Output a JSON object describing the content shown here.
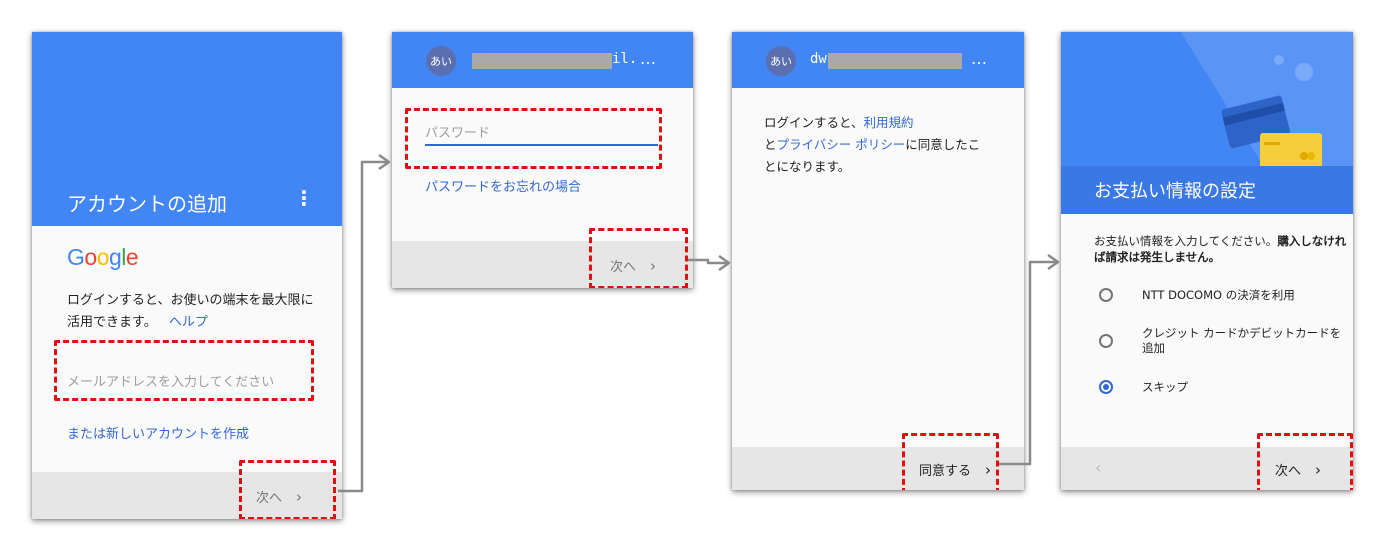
{
  "screen1": {
    "title": "アカウントの追加",
    "menu_icon": "⋮",
    "logo": "Google",
    "logo_colors": [
      "#4285F4",
      "#EA4335",
      "#FBBC05",
      "#4285F4",
      "#34A853",
      "#EA4335"
    ],
    "description": "ログインすると、お使いの端末を最大限に活用できます。",
    "help_link": "ヘルプ",
    "email_placeholder": "メールアドレスを入力してください",
    "create_account_link": "または新しいアカウントを作成",
    "next_label": "次へ",
    "chevron": "›"
  },
  "screen2": {
    "avatar_text": "あい",
    "account_suffix": "il.",
    "more_icon": "…",
    "password_placeholder": "パスワード",
    "forgot_link": "パスワードをお忘れの場合",
    "next_label": "次へ",
    "chevron": "›"
  },
  "screen3": {
    "avatar_text": "あい",
    "account_prefix": "dw",
    "more_icon": "…",
    "terms_text_1": "ログインすると、",
    "terms_link": "利用規約",
    "terms_text_2": "と",
    "privacy_link": "プライバシー ポリシー",
    "terms_text_3": "に同意したことになります。",
    "agree_label": "同意する",
    "chevron": "›"
  },
  "screen4": {
    "title": "お支払い情報の設定",
    "intro_normal": "お支払い情報を入力してください。",
    "intro_bold": "購入しなければ請求は発生しません。",
    "options": [
      {
        "label": "NTT DOCOMO の決済を利用",
        "selected": false
      },
      {
        "label": "クレジット カードかデビットカードを追加",
        "selected": false
      },
      {
        "label": "スキップ",
        "selected": true
      }
    ],
    "back_chevron": "‹",
    "next_label": "次へ",
    "chevron": "›"
  },
  "colors": {
    "header_blue": "#4285f4",
    "header_dark_blue": "#3a78e6",
    "link_blue": "#3367d6",
    "highlight_red": "#e01010",
    "card_yellow": "#f4cf3b"
  }
}
